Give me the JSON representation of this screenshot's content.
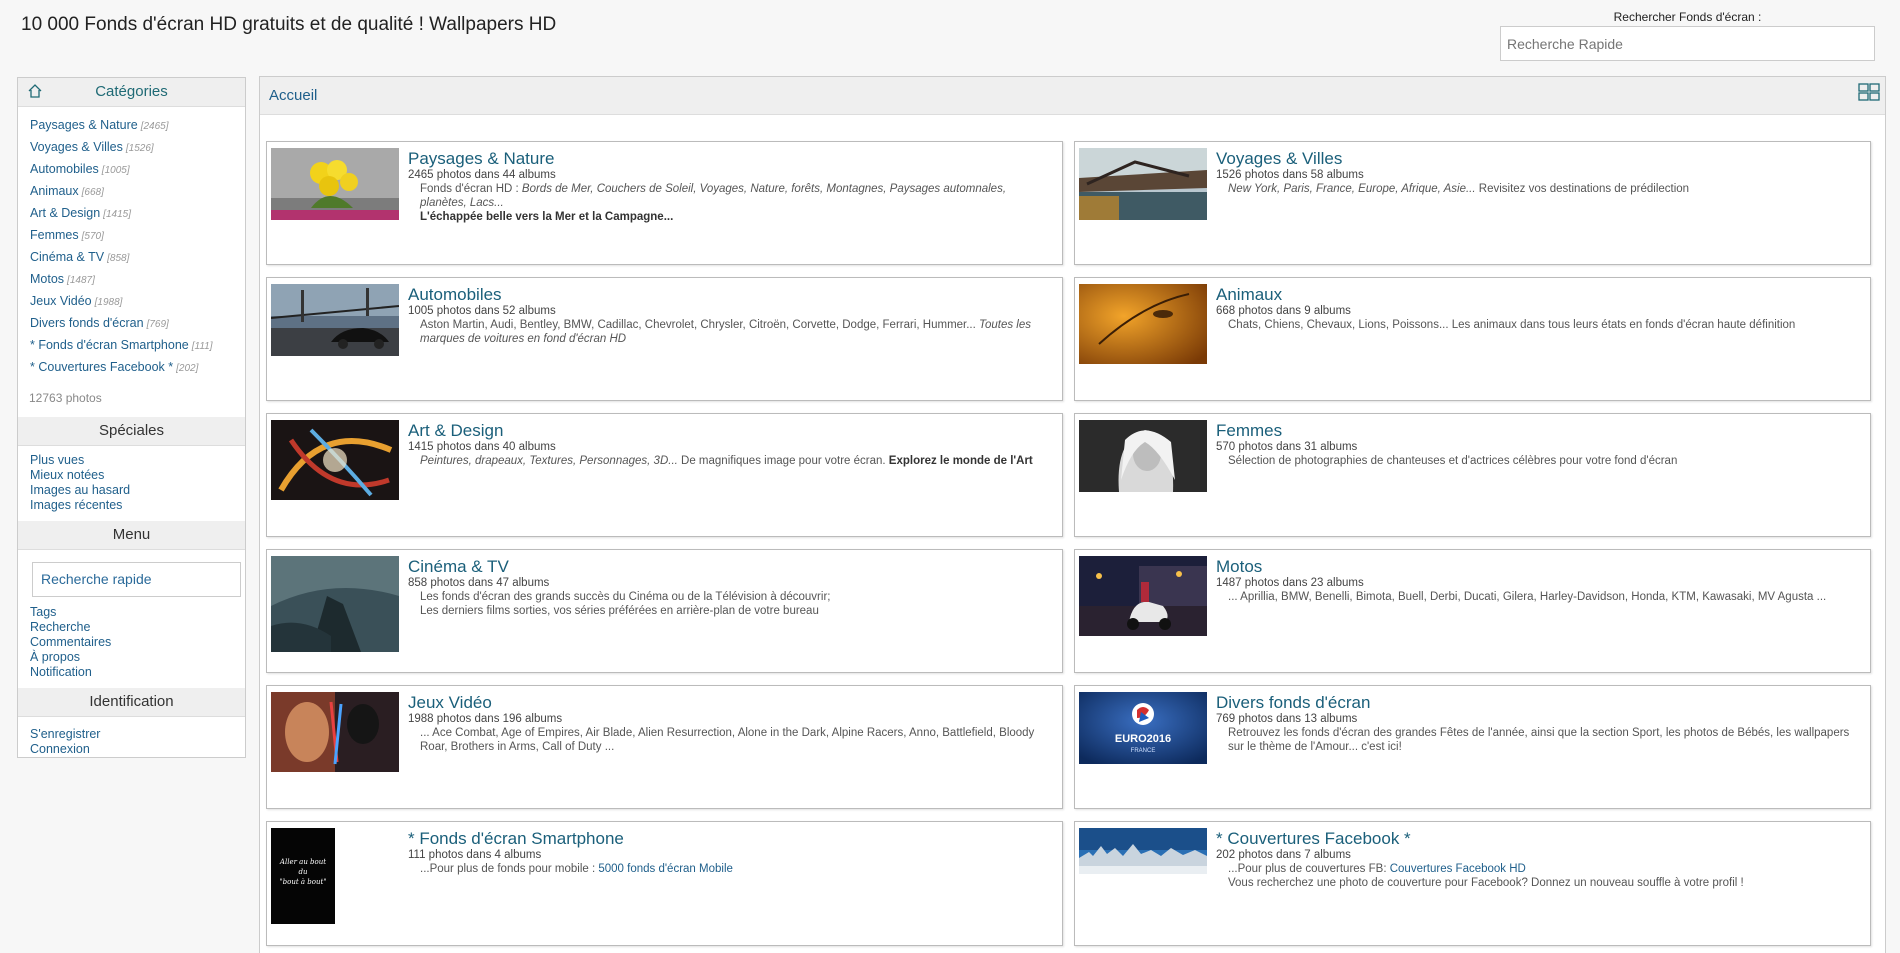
{
  "site": {
    "title": "10 000 Fonds d'écran HD gratuits et de qualité ! Wallpapers HD"
  },
  "search": {
    "label": "Rechercher Fonds d'écran :",
    "placeholder": "Recherche Rapide"
  },
  "sidebar": {
    "categories_title": "Catégories",
    "categories": [
      {
        "label": "Paysages & Nature",
        "count": "[2465]"
      },
      {
        "label": "Voyages & Villes",
        "count": "[1526]"
      },
      {
        "label": "Automobiles",
        "count": "[1005]"
      },
      {
        "label": "Animaux",
        "count": "[668]"
      },
      {
        "label": "Art & Design",
        "count": "[1415]"
      },
      {
        "label": "Femmes",
        "count": "[570]"
      },
      {
        "label": "Cinéma & TV",
        "count": "[858]"
      },
      {
        "label": "Motos",
        "count": "[1487]"
      },
      {
        "label": "Jeux Vidéo",
        "count": "[1988]"
      },
      {
        "label": "Divers fonds d'écran",
        "count": "[769]"
      },
      {
        "label": "* Fonds d'écran Smartphone",
        "count": "[111]"
      },
      {
        "label": "* Couvertures Facebook *",
        "count": "[202]"
      }
    ],
    "total": "12763 photos",
    "speciales_title": "Spéciales",
    "speciales": [
      "Plus vues",
      "Mieux notées",
      "Images au hasard",
      "Images récentes"
    ],
    "menu_title": "Menu",
    "menu_search": "Recherche rapide",
    "menu": [
      "Tags",
      "Recherche",
      "Commentaires",
      "À propos",
      "Notification"
    ],
    "ident_title": "Identification",
    "ident": [
      "S'enregistrer",
      "Connexion"
    ]
  },
  "main": {
    "breadcrumb": "Accueil",
    "cards": [
      {
        "title": "Paysages & Nature",
        "meta": "2465 photos dans 44 albums",
        "d1": "Fonds d'écran HD : ",
        "d1i": "Bords de Mer, Couchers de Soleil, Voyages, Nature, forêts, Montagnes, Paysages automnales, planètes, Lacs...",
        "d2b": "L'échappée belle vers la Mer et la Campagne..."
      },
      {
        "title": "Voyages & Villes",
        "meta": "1526 photos dans 58 albums",
        "d1i": "New York, Paris, France, Europe, Afrique, Asie...",
        "d1": " Revisitez vos destinations de prédilection"
      },
      {
        "title": "Automobiles",
        "meta": "1005 photos dans 52 albums",
        "d1": "Aston Martin, Audi, Bentley, BMW, Cadillac, Chevrolet, Chrysler, Citroën, Corvette, Dodge, Ferrari, Hummer... ",
        "d1i": "Toutes les marques de voitures en fond d'écran HD"
      },
      {
        "title": "Animaux",
        "meta": "668 photos dans 9 albums",
        "d1": "Chats, Chiens, Chevaux, Lions, Poissons... Les animaux dans tous leurs états en fonds d'écran haute définition"
      },
      {
        "title": "Art & Design",
        "meta": "1415 photos dans 40 albums",
        "d1i": "Peintures, drapeaux, Textures, Personnages, 3D...",
        "d1": " De magnifiques image pour votre écran. ",
        "d1b": "Explorez le monde de l'Art"
      },
      {
        "title": "Femmes",
        "meta": "570 photos dans 31 albums",
        "d1": "Sélection de photographies de chanteuses et d'actrices célèbres pour votre fond d'écran"
      },
      {
        "title": "Cinéma & TV",
        "meta": "858 photos dans 47 albums",
        "d1": "Les fonds d'écran des grands succès du Cinéma ou de la Télévision à découvrir;",
        "d2": "Les derniers films sorties, vos séries préférées en arrière-plan de votre bureau"
      },
      {
        "title": "Motos",
        "meta": "1487 photos dans 23 albums",
        "d1": "... Aprillia, BMW, Benelli, Bimota, Buell, Derbi, Ducati, Gilera, Harley-Davidson, Honda, KTM, Kawasaki, MV Agusta ..."
      },
      {
        "title": "Jeux Vidéo",
        "meta": "1988 photos dans 196 albums",
        "d1": "... Ace Combat, Age of Empires, Air Blade, Alien Resurrection, Alone in the Dark, Alpine Racers, Anno, Battlefield, Bloody Roar, Brothers in Arms, Call of Duty ..."
      },
      {
        "title": "Divers fonds d'écran",
        "meta": "769 photos dans 13 albums",
        "d1": "Retrouvez les fonds d'écran des grandes Fêtes de l'année, ainsi que la section Sport, les photos de Bébés, les wallpapers sur le thème de l'Amour... c'est ici!"
      },
      {
        "title": "* Fonds d'écran Smartphone",
        "meta": "111 photos dans 4 albums",
        "d1": "...Pour plus de fonds pour mobile : ",
        "d1a": "5000 fonds d'écran Mobile"
      },
      {
        "title": "* Couvertures Facebook *",
        "meta": "202 photos dans 7 albums",
        "d1": "...Pour plus de couvertures FB: ",
        "d1a": "Couvertures Facebook HD",
        "d2": "Vous recherchez une photo de couverture pour Facebook? Donnez un nouveau souffle à votre profil !"
      }
    ]
  },
  "thumbs": {
    "euro_text": "EURO2016",
    "euro_sub": "FRANCE",
    "smartphone_text": [
      "Aller au bout",
      "du",
      "\"bout à bout\""
    ]
  }
}
